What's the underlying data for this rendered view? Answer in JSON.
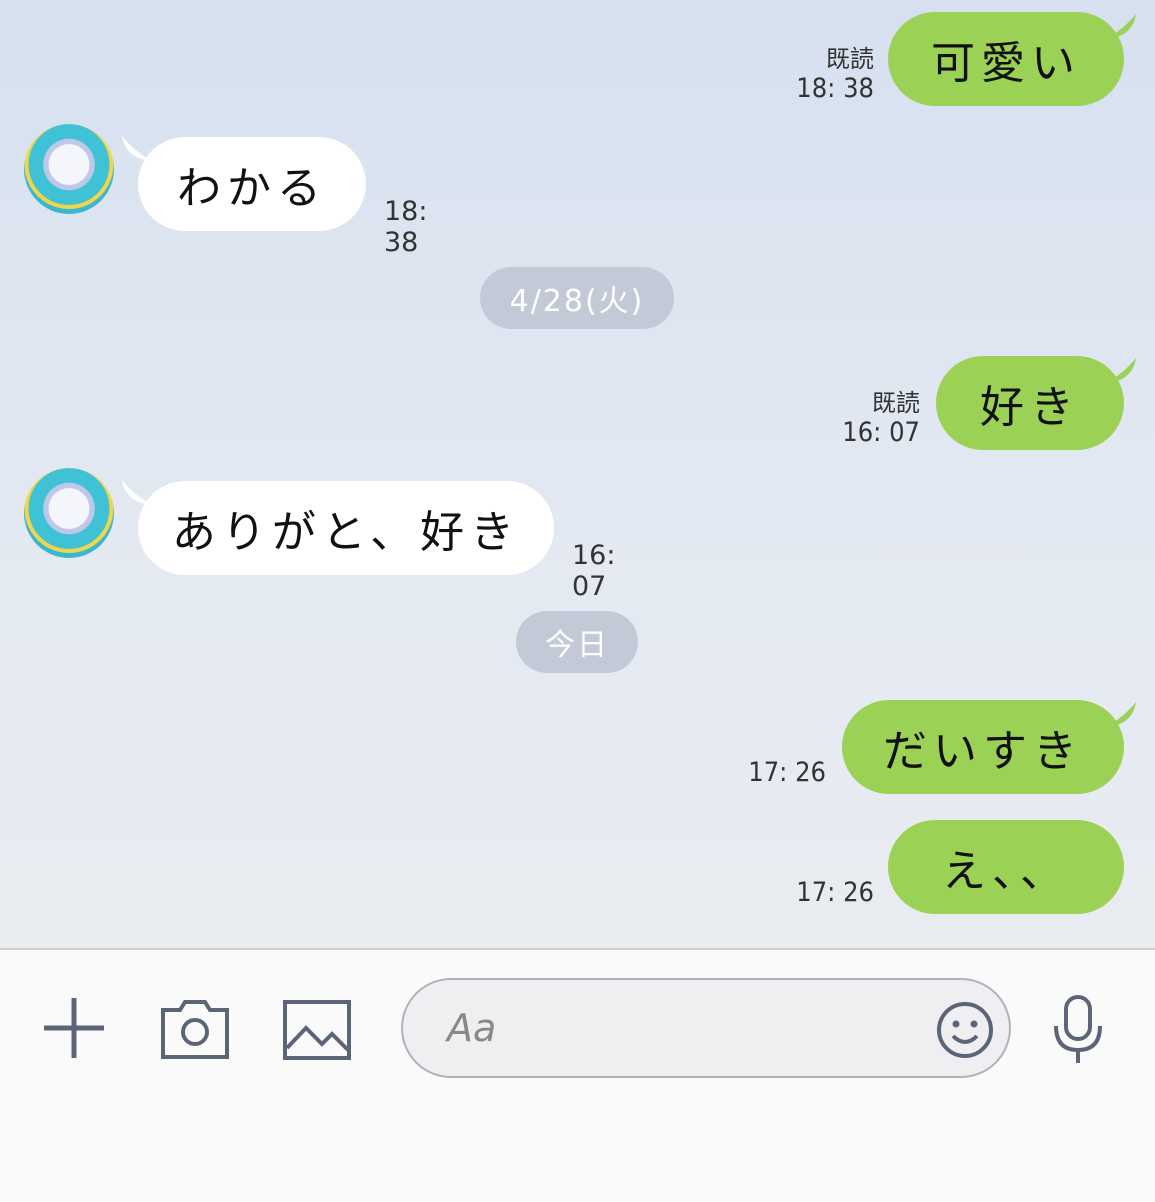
{
  "messages": [
    {
      "side": "out",
      "text": "可愛い",
      "read": "既読",
      "time": "18: 38"
    },
    {
      "side": "in",
      "text": "わかる",
      "time": "18: 38"
    },
    {
      "date": "4/28(火)"
    },
    {
      "side": "out",
      "text": "好き",
      "read": "既読",
      "time": "16: 07"
    },
    {
      "side": "in",
      "text": "ありがと、好き",
      "time": "16: 07"
    },
    {
      "date": "今日"
    },
    {
      "side": "out",
      "text": "だいすき",
      "time": "17: 26"
    },
    {
      "side": "out",
      "text": "え、、",
      "time": "17: 26"
    }
  ],
  "input": {
    "placeholder": "Aa"
  },
  "icons": {
    "add": "plus-icon",
    "camera": "camera-icon",
    "gallery": "image-icon",
    "emoji": "smiley-icon",
    "mic": "microphone-icon"
  },
  "colors": {
    "outgoing": "#9bd155",
    "incoming": "#ffffff",
    "chip": "#c3c9d6"
  }
}
